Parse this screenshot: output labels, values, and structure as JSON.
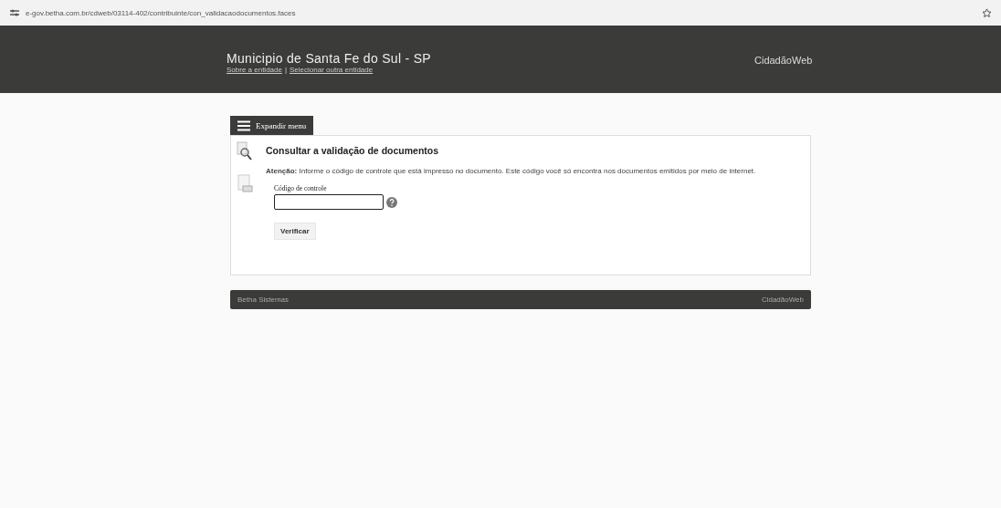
{
  "address_bar": {
    "url": "e-gov.betha.com.br/cdweb/03114-402/contribuinte/con_validacaodocumentos.faces"
  },
  "header": {
    "title": "Municipio de Santa Fe do Sul - SP",
    "links": [
      "Sobre a entidade",
      "Selecionar outra entidade"
    ],
    "separator": "|",
    "brand": "CidadãoWeb"
  },
  "menu_button": {
    "label": "Expandir menu"
  },
  "panel": {
    "title": "Consultar a validação de documentos",
    "notice": "**Atenção:** Informe o código de controle que está impresso no documento. Este código você só encontra nos documentos emitidos por meio de internet.",
    "field": {
      "label": "Código de controle"
    },
    "button": "Verificar"
  },
  "footer": {
    "left": "Betha Sistemas",
    "right": "CidadãoWeb"
  }
}
